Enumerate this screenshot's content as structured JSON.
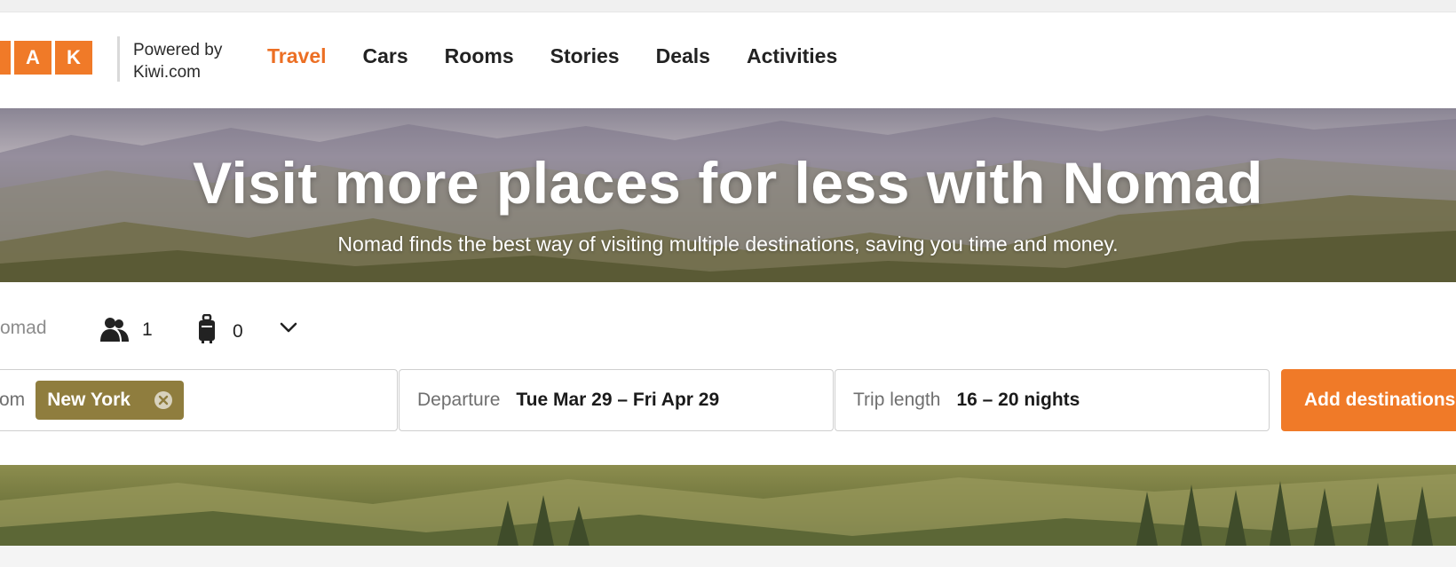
{
  "logo": {
    "letters": [
      "A",
      "K"
    ]
  },
  "powered_by": {
    "line1": "Powered by",
    "line2": "Kiwi.com"
  },
  "nav": {
    "items": [
      {
        "label": "Travel",
        "active": true
      },
      {
        "label": "Cars",
        "active": false
      },
      {
        "label": "Rooms",
        "active": false
      },
      {
        "label": "Stories",
        "active": false
      },
      {
        "label": "Deals",
        "active": false
      },
      {
        "label": "Activities",
        "active": false
      }
    ]
  },
  "hero": {
    "title": "Visit more places for less with Nomad",
    "subtitle": "Nomad finds the best way of visiting multiple destinations, saving you time and money."
  },
  "search": {
    "mode_label": "omad",
    "travelers_count": "1",
    "bags_count": "0",
    "from": {
      "label": "om",
      "chip": "New York"
    },
    "departure": {
      "label": "Departure",
      "value": "Tue Mar 29 – Fri Apr 29"
    },
    "trip_length": {
      "label": "Trip length",
      "value": "16 – 20 nights"
    },
    "add_button": "Add destinations"
  },
  "colors": {
    "accent": "#f07a28",
    "active_nav": "#ec6f24",
    "chip": "#8f7d3e"
  },
  "icons": [
    "travelers-icon",
    "baggage-icon",
    "chevron-down-icon",
    "clear-icon"
  ]
}
